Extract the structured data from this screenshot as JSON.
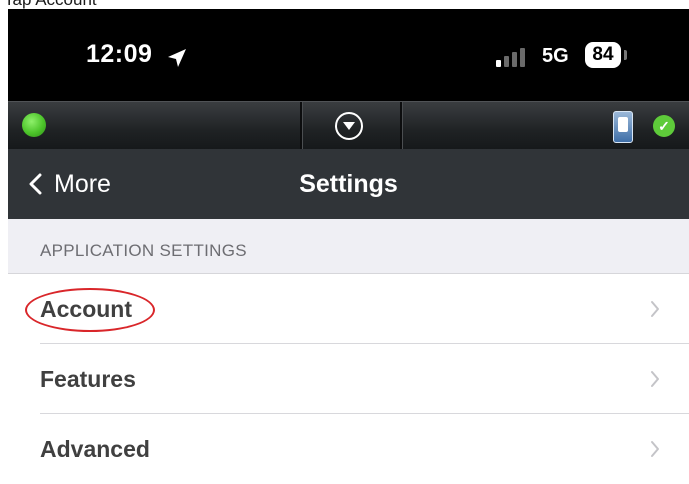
{
  "caption": "Tap Account",
  "status_bar": {
    "time": "12:09",
    "network": "5G",
    "battery": "84"
  },
  "nav": {
    "back_label": "More",
    "title": "Settings"
  },
  "section_header": "APPLICATION SETTINGS",
  "rows": [
    {
      "label": "Account"
    },
    {
      "label": "Features"
    },
    {
      "label": "Advanced"
    }
  ],
  "colors": {
    "status_bar": "#000000",
    "toolbar": "#1f2224",
    "nav_bar": "#303438",
    "section_bg": "#efeff4",
    "annotation": "#d9262a",
    "connected": "#4cc42a"
  },
  "icons": [
    "location-arrow-icon",
    "signal-icon",
    "battery-icon",
    "connection-status-icon",
    "dropdown-icon",
    "device-icon",
    "checkmark-icon",
    "back-chevron-icon",
    "chevron-right-icon"
  ]
}
